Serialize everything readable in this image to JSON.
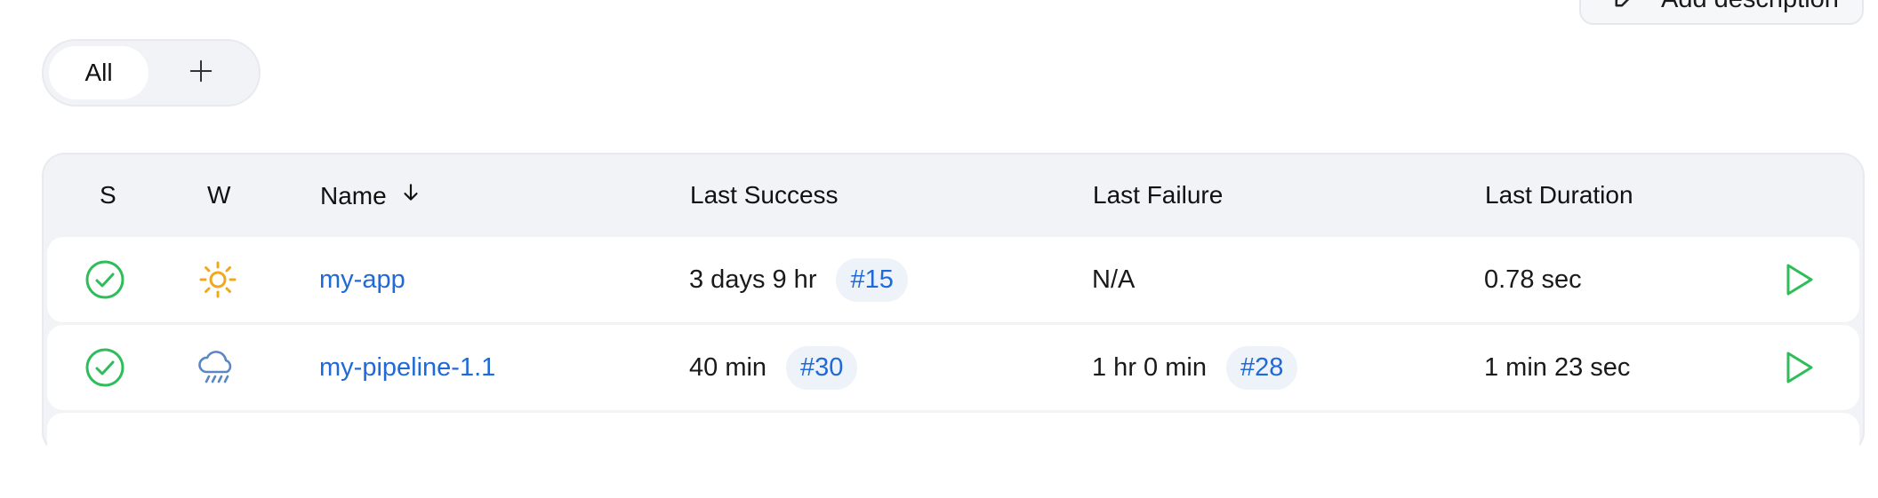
{
  "header": {
    "add_description_label": "Add description"
  },
  "tabs": {
    "all_label": "All",
    "add_icon": "plus-icon"
  },
  "table": {
    "columns": {
      "status": "S",
      "weather": "W",
      "name": "Name",
      "last_success": "Last Success",
      "last_failure": "Last Failure",
      "last_duration": "Last Duration"
    },
    "sort_icon": "arrow-down-icon",
    "rows": [
      {
        "status_icon": "success-check-icon",
        "weather_icon": "sunny-icon",
        "name": "my-app",
        "last_success_time": "3 days 9 hr",
        "last_success_build": "#15",
        "last_failure_time": "N/A",
        "last_failure_build": "",
        "last_duration": "0.78 sec",
        "action_icon": "play-icon"
      },
      {
        "status_icon": "success-check-icon",
        "weather_icon": "rainy-icon",
        "name": "my-pipeline-1.1",
        "last_success_time": "40 min",
        "last_success_build": "#30",
        "last_failure_time": "1 hr 0 min",
        "last_failure_build": "#28",
        "last_duration": "1 min 23 sec",
        "action_icon": "play-icon"
      }
    ]
  },
  "colors": {
    "success": "#2ebd59",
    "link": "#1f6ad8",
    "sun": "#f0a81c",
    "rain": "#5a86c4"
  }
}
